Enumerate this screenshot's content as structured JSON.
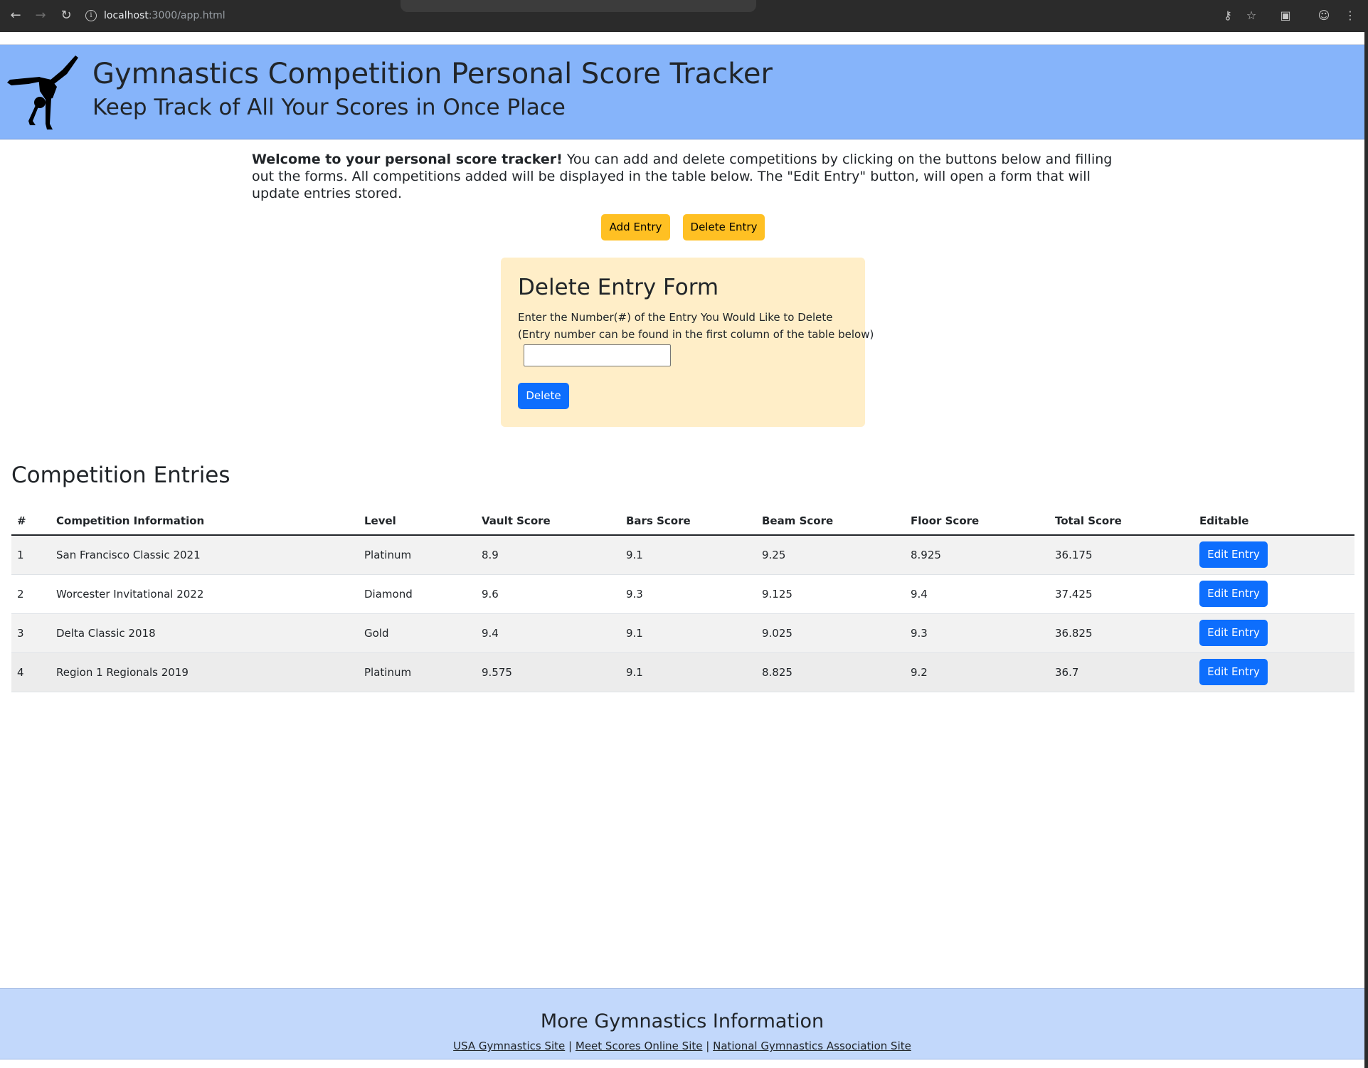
{
  "browser": {
    "url_host": "localhost",
    "url_path": ":3000/app.html"
  },
  "header": {
    "title": "Gymnastics Competition Personal Score Tracker",
    "subtitle": "Keep Track of All Your Scores in Once Place",
    "logo_icon": "gymnast-handstand-icon"
  },
  "intro": {
    "bold": "Welcome to your personal score tracker!",
    "text": " You can add and delete competitions by clicking on the buttons below and filling out the forms. All competitions added will be displayed in the table below. The \"Edit Entry\" button, will open a form that will update entries stored."
  },
  "actions": {
    "add_label": "Add Entry",
    "delete_label": "Delete Entry"
  },
  "delete_form": {
    "title": "Delete Entry Form",
    "label_line1": "Enter the Number(#) of the Entry You Would Like to Delete",
    "label_line2": "(Entry number can be found in the first column of the table below)",
    "input_value": "",
    "submit_label": "Delete"
  },
  "entries": {
    "title": "Competition Entries",
    "columns": [
      "#",
      "Competition Information",
      "Level",
      "Vault Score",
      "Bars Score",
      "Beam Score",
      "Floor Score",
      "Total Score",
      "Editable"
    ],
    "rows": [
      {
        "num": "1",
        "info": "San Francisco Classic 2021",
        "level": "Platinum",
        "vault": "8.9",
        "bars": "9.1",
        "beam": "9.25",
        "floor": "8.925",
        "total": "36.175",
        "edit": "Edit Entry"
      },
      {
        "num": "2",
        "info": "Worcester Invitational 2022",
        "level": "Diamond",
        "vault": "9.6",
        "bars": "9.3",
        "beam": "9.125",
        "floor": "9.4",
        "total": "37.425",
        "edit": "Edit Entry"
      },
      {
        "num": "3",
        "info": "Delta Classic 2018",
        "level": "Gold",
        "vault": "9.4",
        "bars": "9.1",
        "beam": "9.025",
        "floor": "9.3",
        "total": "36.825",
        "edit": "Edit Entry"
      },
      {
        "num": "4",
        "info": "Region 1 Regionals 2019",
        "level": "Platinum",
        "vault": "9.575",
        "bars": "9.1",
        "beam": "8.825",
        "floor": "9.2",
        "total": "36.7",
        "edit": "Edit Entry"
      }
    ]
  },
  "footer": {
    "title": "More Gymnastics Information",
    "link1": "USA Gymnastics Site",
    "link2": "Meet Scores Online Site",
    "link3": "National Gymnastics Association Site",
    "separator": "|"
  },
  "colors": {
    "banner": "#86b4fa",
    "footer": "#c2d8fb",
    "warning": "#ffc023",
    "primary": "#0d6efd",
    "form_bg": "#ffeec8"
  }
}
